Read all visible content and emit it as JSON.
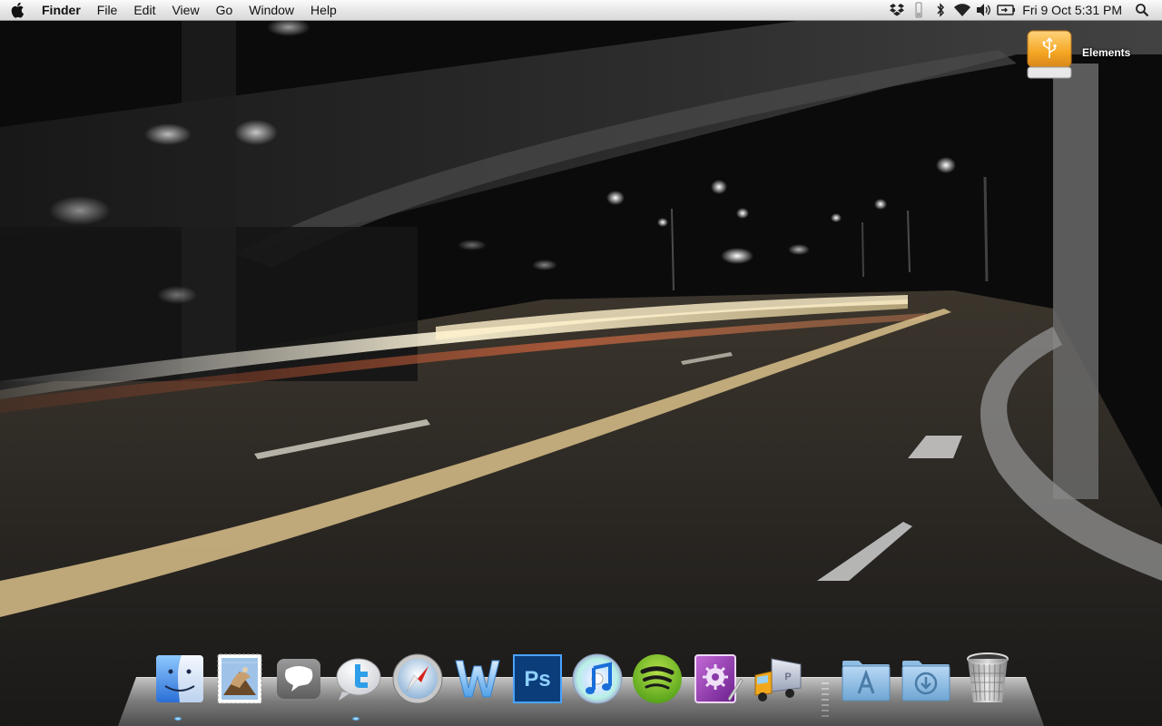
{
  "menubar": {
    "apple_icon": "apple-icon",
    "app_name": "Finder",
    "menus": [
      "File",
      "Edit",
      "View",
      "Go",
      "Window",
      "Help"
    ],
    "status_icons": [
      "dropbox-icon",
      "battery-level-icon",
      "bluetooth-icon",
      "wifi-icon",
      "volume-icon",
      "display-mirror-icon"
    ],
    "clock": "Fri 9 Oct  5:31 PM",
    "spotlight_icon": "spotlight-search-icon"
  },
  "desktop": {
    "icons": [
      {
        "label": "Elements",
        "icon": "external-usb-drive-icon"
      }
    ]
  },
  "dock": {
    "apps": [
      {
        "name": "Finder",
        "icon": "finder-icon",
        "running": true
      },
      {
        "name": "Mail",
        "icon": "mail-icon",
        "running": false
      },
      {
        "name": "Messages",
        "icon": "speech-bubble-icon",
        "running": false
      },
      {
        "name": "Twitter",
        "icon": "twitter-icon",
        "running": true
      },
      {
        "name": "Safari",
        "icon": "safari-compass-icon",
        "running": false
      },
      {
        "name": "Word",
        "icon": "word-icon",
        "running": false
      },
      {
        "name": "Photoshop",
        "icon": "photoshop-icon",
        "running": false
      },
      {
        "name": "iTunes",
        "icon": "itunes-icon",
        "running": false
      },
      {
        "name": "Spotify",
        "icon": "spotify-icon",
        "running": false
      },
      {
        "name": "Script Editor",
        "icon": "script-editor-icon",
        "running": false
      },
      {
        "name": "Transmit",
        "icon": "delivery-truck-icon",
        "running": false
      }
    ],
    "folders": [
      {
        "name": "Applications",
        "icon": "applications-folder-icon"
      },
      {
        "name": "Downloads",
        "icon": "downloads-folder-icon"
      },
      {
        "name": "Trash",
        "icon": "trash-icon"
      }
    ]
  }
}
